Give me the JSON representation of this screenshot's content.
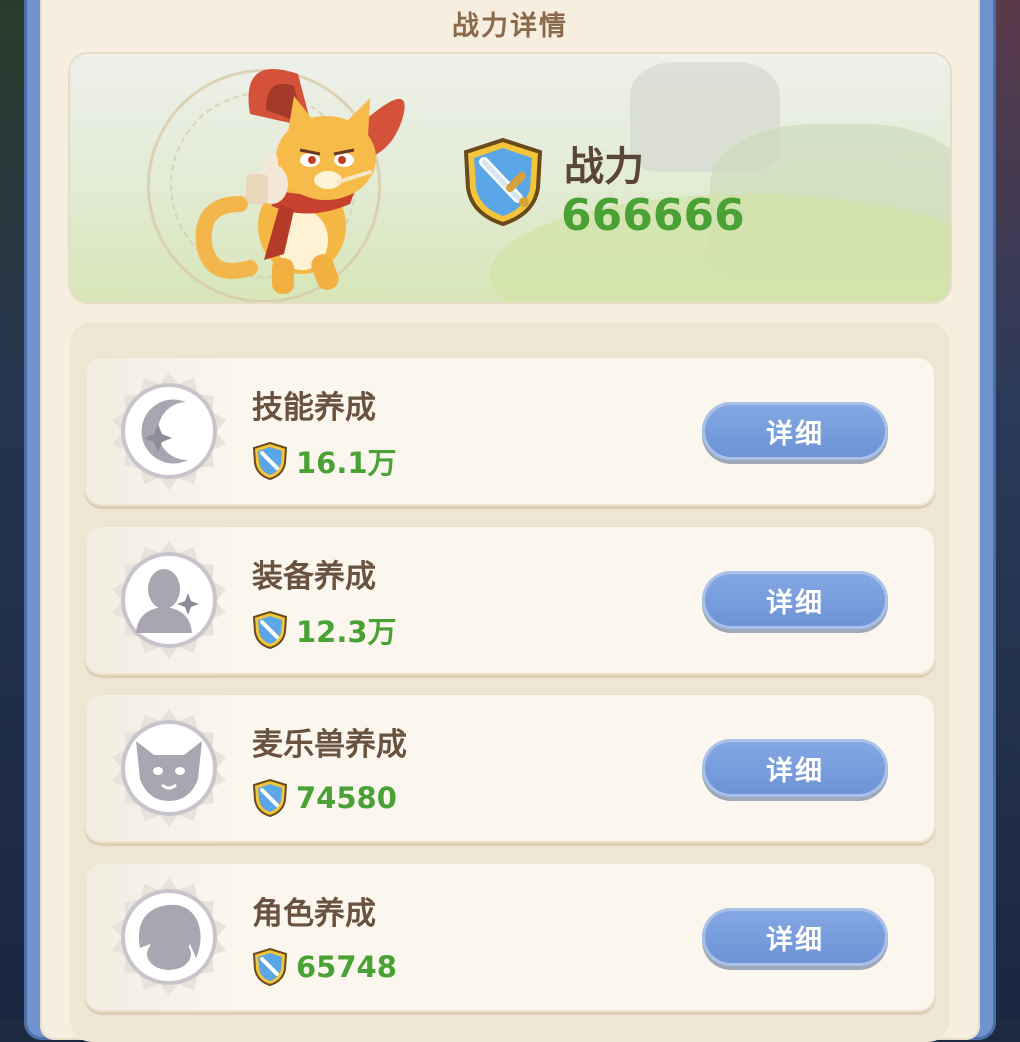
{
  "panel": {
    "title": "战力详情"
  },
  "power": {
    "label": "战力",
    "value": "666666"
  },
  "items": [
    {
      "title": "技能养成",
      "value": "16.1万",
      "button": "详细",
      "icon": "moon-star-icon"
    },
    {
      "title": "装备养成",
      "value": "12.3万",
      "button": "详细",
      "icon": "hero-silhouette-icon"
    },
    {
      "title": "麦乐兽养成",
      "value": "74580",
      "button": "详细",
      "icon": "cat-face-icon"
    },
    {
      "title": "角色养成",
      "value": "65748",
      "button": "详细",
      "icon": "character-head-icon"
    }
  ],
  "colors": {
    "frame": "#6f93cf",
    "panel": "#f6efe0",
    "value_green": "#4aa236",
    "button_blue": "#6b92d6",
    "title_brown": "#6a5240"
  }
}
